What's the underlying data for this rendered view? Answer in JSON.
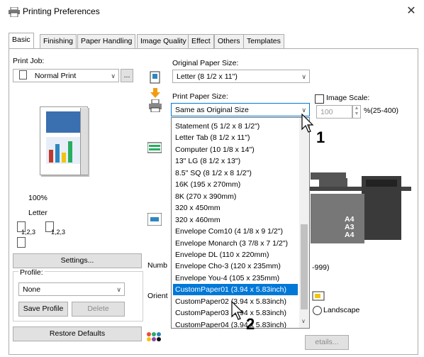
{
  "window": {
    "title": "Printing Preferences",
    "close": "✕"
  },
  "tabs": [
    "Basic",
    "Finishing",
    "Paper Handling",
    "Image Quality",
    "Effect",
    "Others",
    "Templates"
  ],
  "left": {
    "print_job_label": "Print Job:",
    "print_job_value": "Normal Print",
    "print_job_more": "...",
    "preview_percent": "100%",
    "preview_paper": "Letter",
    "preview_copy1": "1,2,3",
    "preview_copy2": "1,2,3",
    "settings_button": "Settings...",
    "profile_label": "Profile:",
    "profile_value": "None",
    "save_profile_button": "Save Profile",
    "delete_button": "Delete",
    "restore_defaults_button": "Restore Defaults"
  },
  "right": {
    "original_size_label": "Original Paper Size:",
    "original_size_value": "Letter (8 1/2 x 11\")",
    "print_size_label": "Print Paper Size:",
    "print_size_value": "Same as Original Size",
    "image_scale_label": "Image Scale:",
    "image_scale_value": "100",
    "image_scale_range": "%(25-400)",
    "number_label_partial": "Numb",
    "number_range_partial": "-999)",
    "orient_label_partial": "Orient",
    "landscape_label": "Landscape",
    "details_partial": "etails..."
  },
  "dropdown": {
    "items": [
      "Statement (5 1/2 x 8 1/2\")",
      "Letter Tab (8 1/2 x 11\")",
      "Computer (10 1/8 x 14\")",
      "13\" LG (8 1/2 x 13\")",
      "8.5\" SQ (8 1/2 x 8 1/2\")",
      "16K (195 x 270mm)",
      "8K (270 x 390mm)",
      "320 x 450mm",
      "320 x 460mm",
      "Envelope Com10 (4 1/8 x 9 1/2\")",
      "Envelope Monarch (3 7/8 x 7 1/2\")",
      "Envelope DL (110 x 220mm)",
      "Envelope Cho-3 (120 x 235mm)",
      "Envelope You-4 (105 x 235mm)",
      "CustomPaper01 (3.94 x 5.83inch)",
      "CustomPaper02 (3.94 x 5.83inch)",
      "CustomPaper03 (3.94 x 5.83inch)",
      "CustomPaper04 (3.94 x 5.83inch)"
    ],
    "selected_index": 14
  },
  "tray_labels": [
    "A4",
    "A3",
    "A4"
  ],
  "callouts": [
    "1",
    "2"
  ],
  "colors": {
    "selection": "#0078d7",
    "border": "#adadad",
    "button": "#e1e1e1"
  }
}
